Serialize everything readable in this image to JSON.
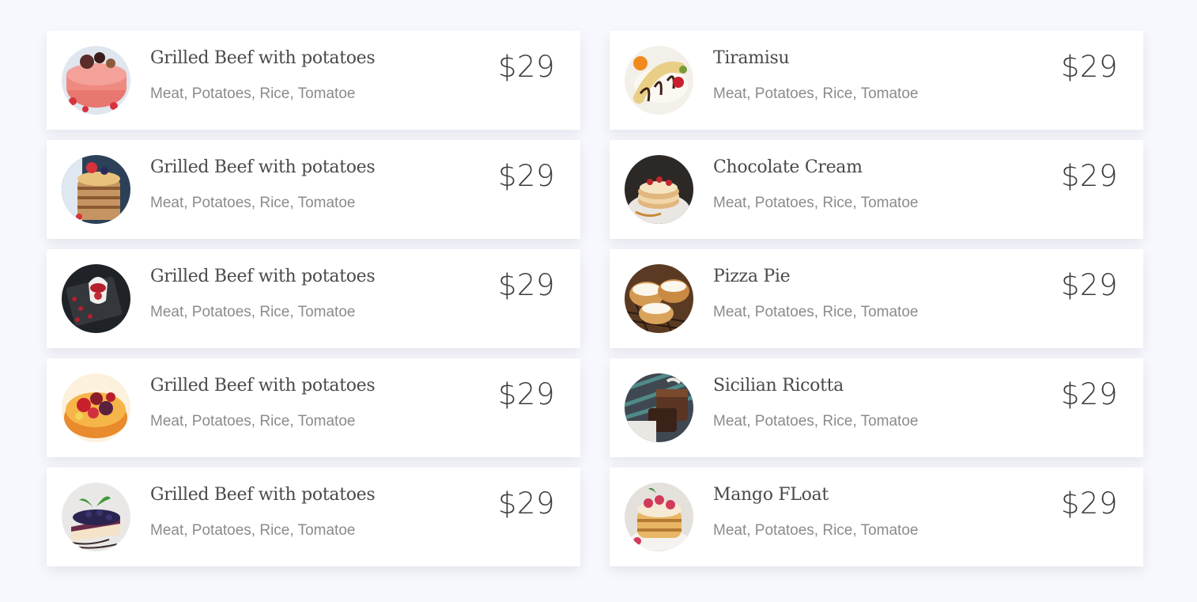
{
  "menu": {
    "items": [
      {
        "name": "Grilled Beef with potatoes",
        "desc": "Meat, Potatoes, Rice, Tomatoe",
        "price": "$29",
        "photo": "strawberry-cake-photo"
      },
      {
        "name": "Tiramisu",
        "desc": "Meat, Potatoes, Rice, Tomatoe",
        "price": "$29",
        "photo": "banana-dessert-photo"
      },
      {
        "name": "Grilled Beef with potatoes",
        "desc": "Meat, Potatoes, Rice, Tomatoe",
        "price": "$29",
        "photo": "pancake-stack-photo"
      },
      {
        "name": "Chocolate Cream",
        "desc": "Meat, Potatoes, Rice, Tomatoe",
        "price": "$29",
        "photo": "crepe-stack-photo"
      },
      {
        "name": "Grilled Beef with potatoes",
        "desc": "Meat, Potatoes, Rice, Tomatoe",
        "price": "$29",
        "photo": "berry-parfait-photo"
      },
      {
        "name": "Pizza Pie",
        "desc": "Meat, Potatoes, Rice, Tomatoe",
        "price": "$29",
        "photo": "cream-puffs-photo"
      },
      {
        "name": "Grilled Beef with potatoes",
        "desc": "Meat, Potatoes, Rice, Tomatoe",
        "price": "$29",
        "photo": "fruit-tart-photo"
      },
      {
        "name": "Sicilian Ricotta",
        "desc": "Meat, Potatoes, Rice, Tomatoe",
        "price": "$29",
        "photo": "chocolate-brownie-photo"
      },
      {
        "name": "Grilled Beef with potatoes",
        "desc": "Meat, Potatoes, Rice, Tomatoe",
        "price": "$29",
        "photo": "blueberry-cheesecake-photo"
      },
      {
        "name": "Mango FLoat",
        "desc": "Meat, Potatoes, Rice, Tomatoe",
        "price": "$29",
        "photo": "raspberry-pancakes-photo"
      }
    ]
  }
}
